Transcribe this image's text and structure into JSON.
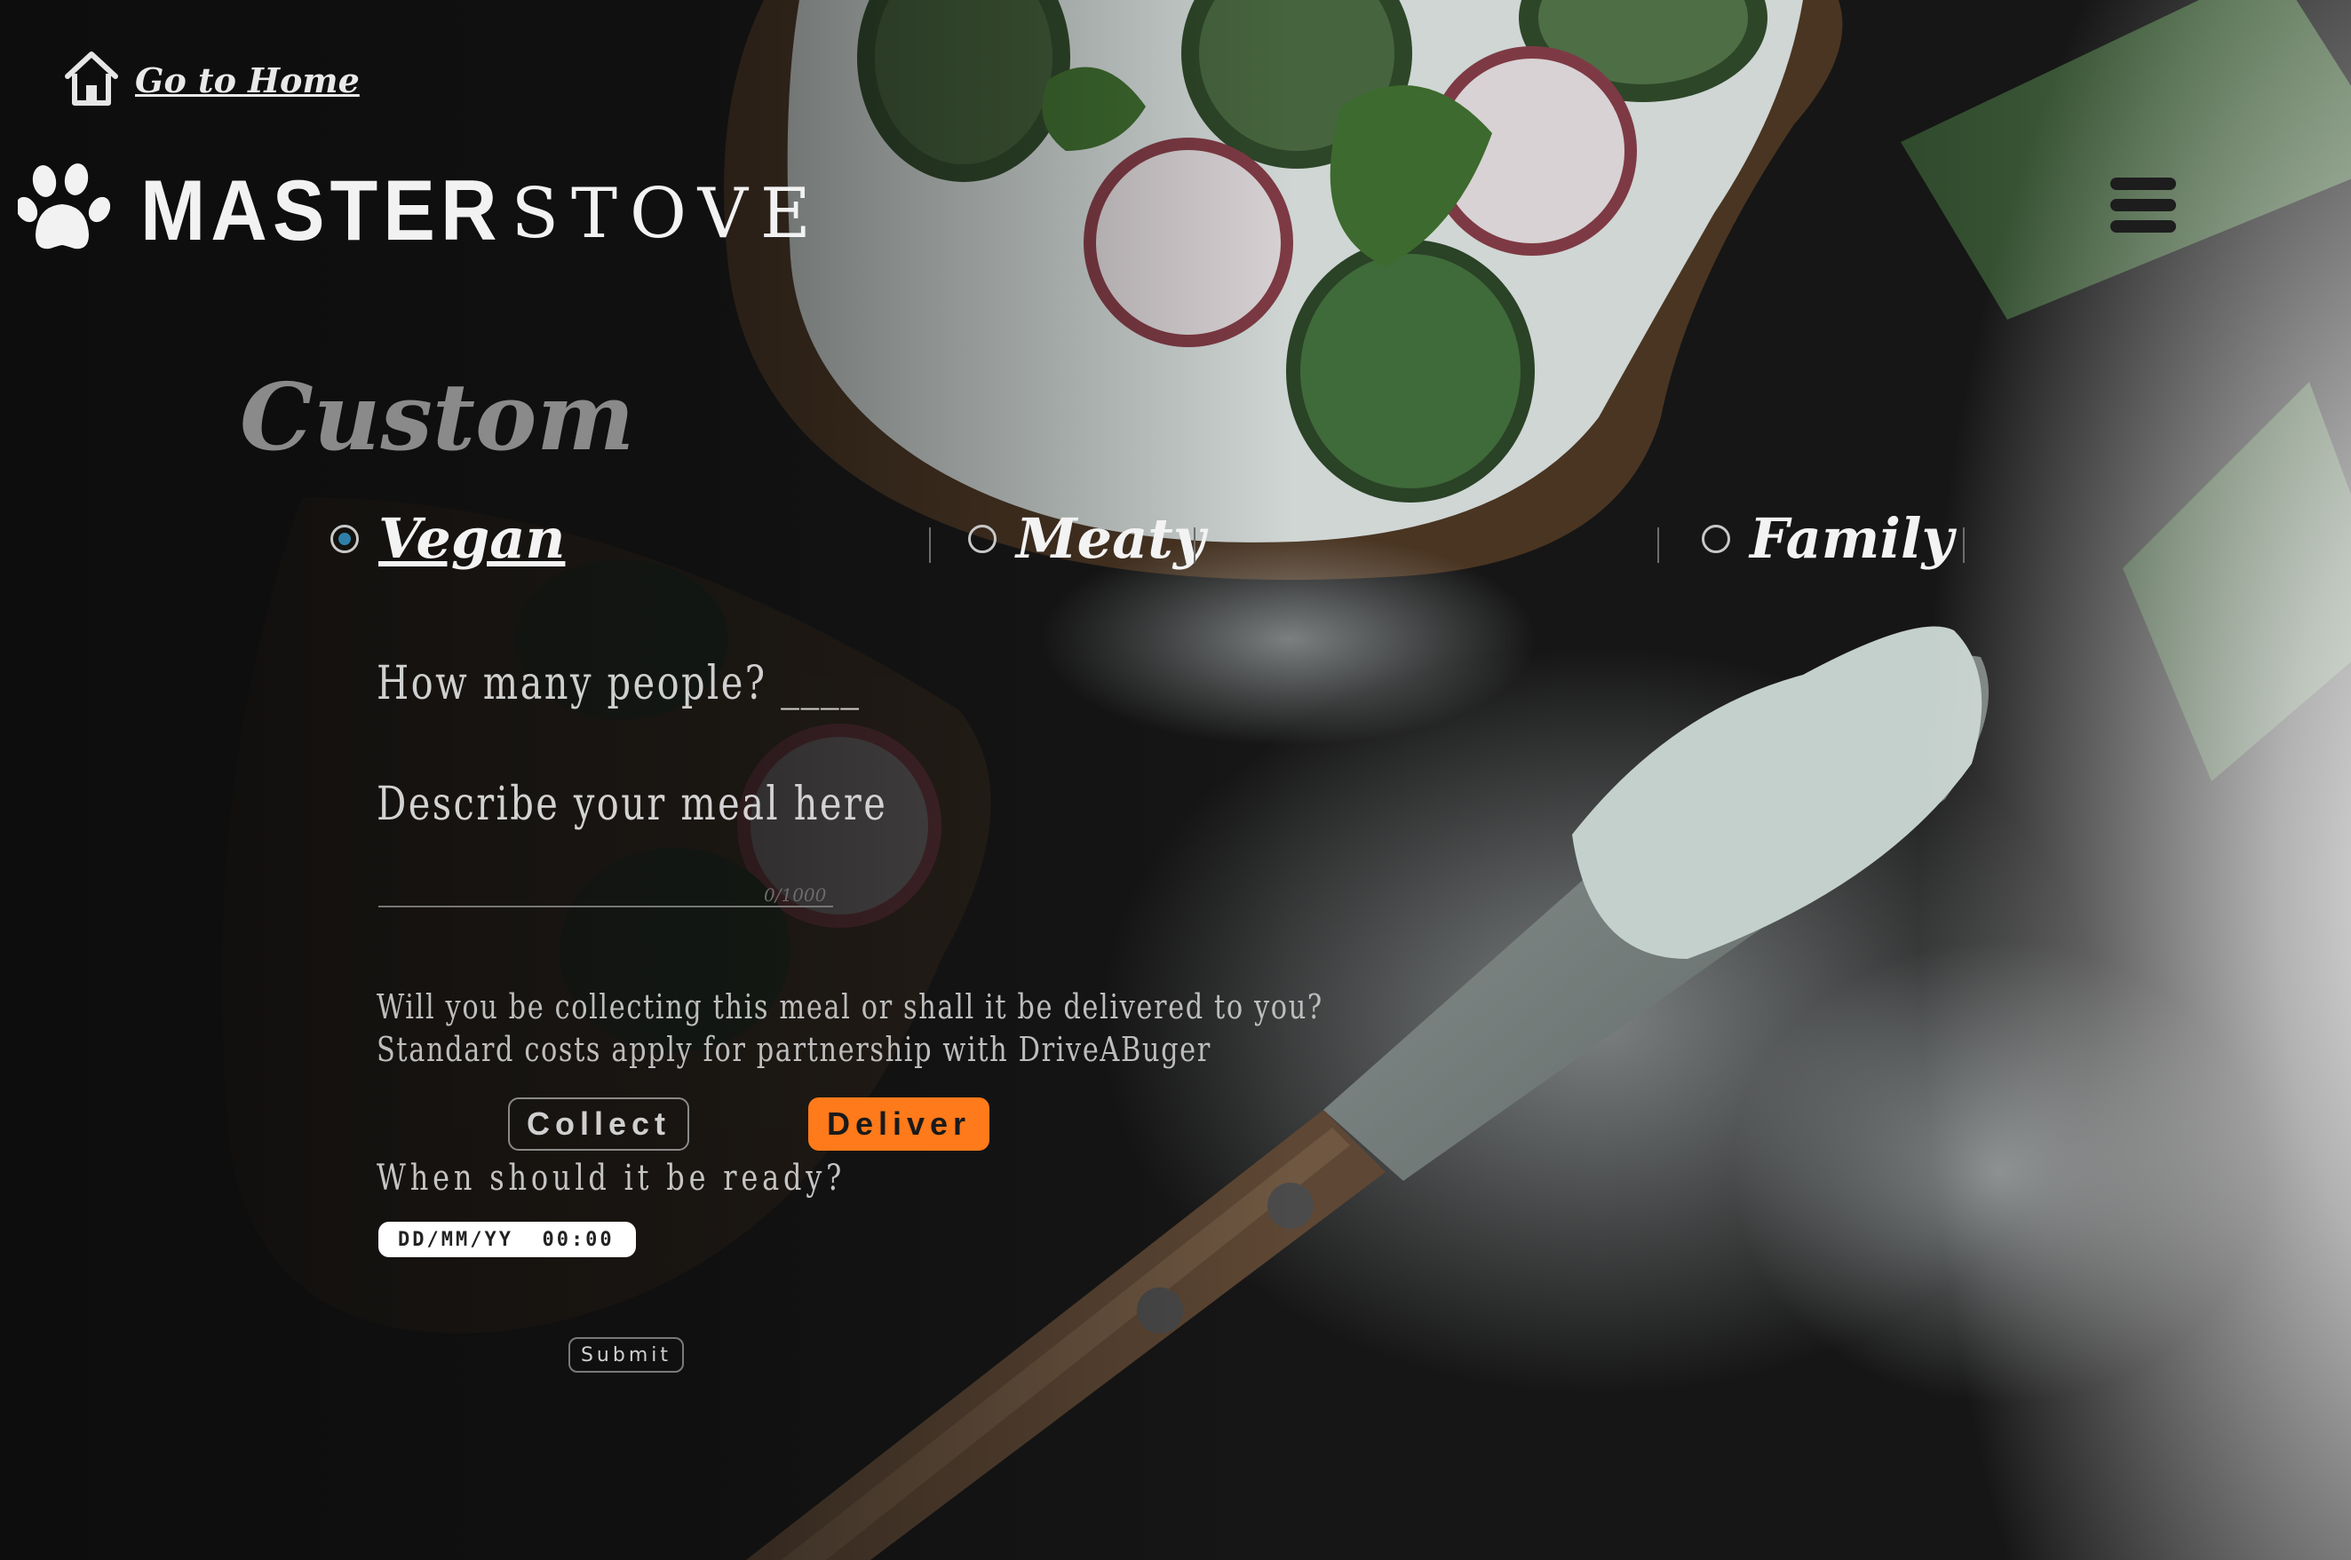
{
  "header": {
    "home_link": "Go to Home",
    "brand_bold": "MASTER",
    "brand_light": "STOVE"
  },
  "form": {
    "title": "Custom",
    "options": [
      {
        "label": "Vegan",
        "selected": true
      },
      {
        "label": "Meaty",
        "selected": false
      },
      {
        "label": "Family",
        "selected": false
      }
    ],
    "people_question": "How many people?",
    "people_value": "____",
    "meal_placeholder": "Describe your meal here",
    "meal_counter": "0/1000",
    "delivery_question_line1": "Will you be collecting this meal or shall it be delivered to you?",
    "delivery_question_line2": "Standard costs apply for partnership with DriveABuger",
    "collect_label": "Collect",
    "deliver_label": "Deliver",
    "ready_question": "When should it be ready?",
    "datetime_placeholder": "DD/MM/YY  00:00",
    "submit_label": "Submit"
  },
  "colors": {
    "accent": "#ff7a1a",
    "radio_selected": "#2f7fa8",
    "background": "#141414"
  },
  "icons": [
    "house-icon",
    "paw-icon",
    "hamburger-menu-icon"
  ]
}
